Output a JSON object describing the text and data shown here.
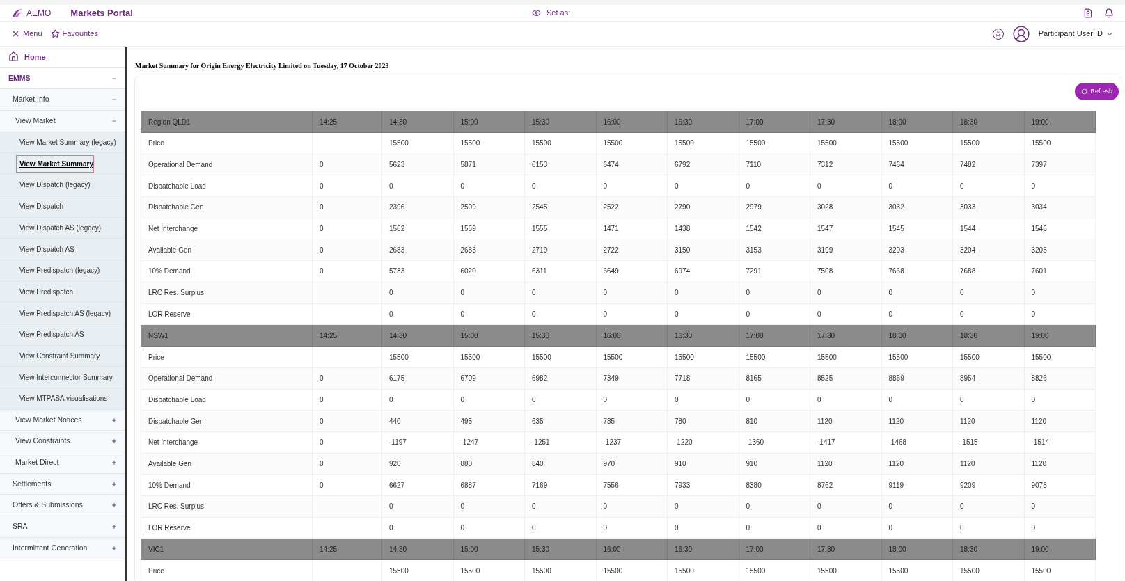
{
  "header": {
    "logo_text": "AEMO",
    "app_title": "Markets Portal",
    "set_as_label": "Set as:"
  },
  "toolbar": {
    "menu": "Menu",
    "favourites": "Favourites",
    "user": "Participant User ID"
  },
  "sidebar": {
    "items": [
      {
        "label": "Home",
        "kind": "home"
      },
      {
        "label": "EMMS",
        "expanded": true,
        "children": [
          {
            "label": "Market Info",
            "expanded": true,
            "children": [
              {
                "label": "View Market",
                "expanded": true,
                "children": [
                  {
                    "label": "View Market Summary (legacy)",
                    "selected": false
                  },
                  {
                    "label": "View Market Summary",
                    "selected": true
                  },
                  {
                    "label": "View Dispatch (legacy)",
                    "selected": false
                  },
                  {
                    "label": "View Dispatch",
                    "selected": false
                  },
                  {
                    "label": "View Dispatch AS (legacy)",
                    "selected": false
                  },
                  {
                    "label": "View Dispatch AS",
                    "selected": false
                  },
                  {
                    "label": "View Predispatch (legacy)",
                    "selected": false
                  },
                  {
                    "label": "View Predispatch",
                    "selected": false
                  },
                  {
                    "label": "View Predispatch AS (legacy)",
                    "selected": false
                  },
                  {
                    "label": "View Predispatch AS",
                    "selected": false
                  },
                  {
                    "label": "View Constraint Summary",
                    "selected": false
                  },
                  {
                    "label": "View Interconnector Summary",
                    "selected": false
                  },
                  {
                    "label": "View MTPASA visualisations",
                    "selected": false
                  }
                ]
              },
              {
                "label": "View Market Notices",
                "expanded": false
              },
              {
                "label": "View Constraints",
                "expanded": false
              },
              {
                "label": "Market Direct",
                "expanded": false
              }
            ]
          },
          {
            "label": "Settlements",
            "expanded": false
          },
          {
            "label": "Offers & Submissions",
            "expanded": false
          },
          {
            "label": "SRA",
            "expanded": false
          },
          {
            "label": "Intermittent Generation",
            "expanded": false
          }
        ]
      }
    ]
  },
  "page_title": "Market Summary for Origin Energy Electricity Limited on Tuesday, 17 October 2023",
  "refresh_button": "Refresh",
  "regions": [
    {
      "name": "Region QLD1",
      "times": [
        "14:25",
        "14:30",
        "15:00",
        "15:30",
        "16:00",
        "16:30",
        "17:00",
        "17:30",
        "18:00",
        "18:30",
        "19:00"
      ],
      "rows": [
        {
          "label": "Price",
          "kind": "forecast",
          "values": [
            "15500",
            "15500",
            "15500",
            "15500",
            "15500",
            "15500",
            "15500",
            "15500",
            "15500",
            "15500"
          ]
        },
        {
          "label": "Operational Demand",
          "values": [
            "0",
            "5623",
            "5871",
            "6153",
            "6474",
            "6792",
            "7110",
            "7312",
            "7464",
            "7482",
            "7397"
          ]
        },
        {
          "label": "Dispatchable Load",
          "values": [
            "0",
            "0",
            "0",
            "0",
            "0",
            "0",
            "0",
            "0",
            "0",
            "0",
            "0"
          ]
        },
        {
          "label": "Dispatchable Gen",
          "values": [
            "0",
            "2396",
            "2509",
            "2545",
            "2522",
            "2790",
            "2979",
            "3028",
            "3032",
            "3033",
            "3034"
          ]
        },
        {
          "label": "Net Interchange",
          "values": [
            "0",
            "1562",
            "1559",
            "1555",
            "1471",
            "1438",
            "1542",
            "1547",
            "1545",
            "1544",
            "1546"
          ]
        },
        {
          "label": "Available Gen",
          "values": [
            "0",
            "2683",
            "2683",
            "2719",
            "2722",
            "3150",
            "3153",
            "3199",
            "3203",
            "3204",
            "3205"
          ]
        },
        {
          "label": "10% Demand",
          "values": [
            "0",
            "5733",
            "6020",
            "6311",
            "6649",
            "6974",
            "7291",
            "7508",
            "7668",
            "7688",
            "7601"
          ]
        },
        {
          "label": "LRC Res. Surplus",
          "kind": "forecast",
          "values": [
            "0",
            "0",
            "0",
            "0",
            "0",
            "0",
            "0",
            "0",
            "0",
            "0"
          ]
        },
        {
          "label": "LOR Reserve",
          "kind": "forecast",
          "values": [
            "0",
            "0",
            "0",
            "0",
            "0",
            "0",
            "0",
            "0",
            "0",
            "0"
          ]
        }
      ]
    },
    {
      "name": "NSW1",
      "times": [
        "14:25",
        "14:30",
        "15:00",
        "15:30",
        "16:00",
        "16:30",
        "17:00",
        "17:30",
        "18:00",
        "18:30",
        "19:00"
      ],
      "rows": [
        {
          "label": "Price",
          "kind": "forecast",
          "values": [
            "15500",
            "15500",
            "15500",
            "15500",
            "15500",
            "15500",
            "15500",
            "15500",
            "15500",
            "15500"
          ]
        },
        {
          "label": "Operational Demand",
          "values": [
            "0",
            "6175",
            "6709",
            "6982",
            "7349",
            "7718",
            "8165",
            "8525",
            "8869",
            "8954",
            "8826"
          ]
        },
        {
          "label": "Dispatchable Load",
          "values": [
            "0",
            "0",
            "0",
            "0",
            "0",
            "0",
            "0",
            "0",
            "0",
            "0",
            "0"
          ]
        },
        {
          "label": "Dispatchable Gen",
          "values": [
            "0",
            "440",
            "495",
            "635",
            "785",
            "780",
            "810",
            "1120",
            "1120",
            "1120",
            "1120"
          ]
        },
        {
          "label": "Net Interchange",
          "values": [
            "0",
            "-1197",
            "-1247",
            "-1251",
            "-1237",
            "-1220",
            "-1360",
            "-1417",
            "-1468",
            "-1515",
            "-1514"
          ]
        },
        {
          "label": "Available Gen",
          "values": [
            "0",
            "920",
            "880",
            "840",
            "970",
            "910",
            "910",
            "1120",
            "1120",
            "1120",
            "1120"
          ]
        },
        {
          "label": "10% Demand",
          "values": [
            "0",
            "6627",
            "6887",
            "7169",
            "7556",
            "7933",
            "8380",
            "8762",
            "9119",
            "9209",
            "9078"
          ]
        },
        {
          "label": "LRC Res. Surplus",
          "kind": "forecast",
          "values": [
            "0",
            "0",
            "0",
            "0",
            "0",
            "0",
            "0",
            "0",
            "0",
            "0"
          ]
        },
        {
          "label": "LOR Reserve",
          "kind": "forecast",
          "values": [
            "0",
            "0",
            "0",
            "0",
            "0",
            "0",
            "0",
            "0",
            "0",
            "0"
          ]
        }
      ]
    },
    {
      "name": "VIC1",
      "times": [
        "14:25",
        "14:30",
        "15:00",
        "15:30",
        "16:00",
        "16:30",
        "17:00",
        "17:30",
        "18:00",
        "18:30",
        "19:00"
      ],
      "rows": [
        {
          "label": "Price",
          "kind": "forecast",
          "values": [
            "15500",
            "15500",
            "15500",
            "15500",
            "15500",
            "15500",
            "15500",
            "15500",
            "15500",
            "15500"
          ]
        }
      ]
    }
  ]
}
